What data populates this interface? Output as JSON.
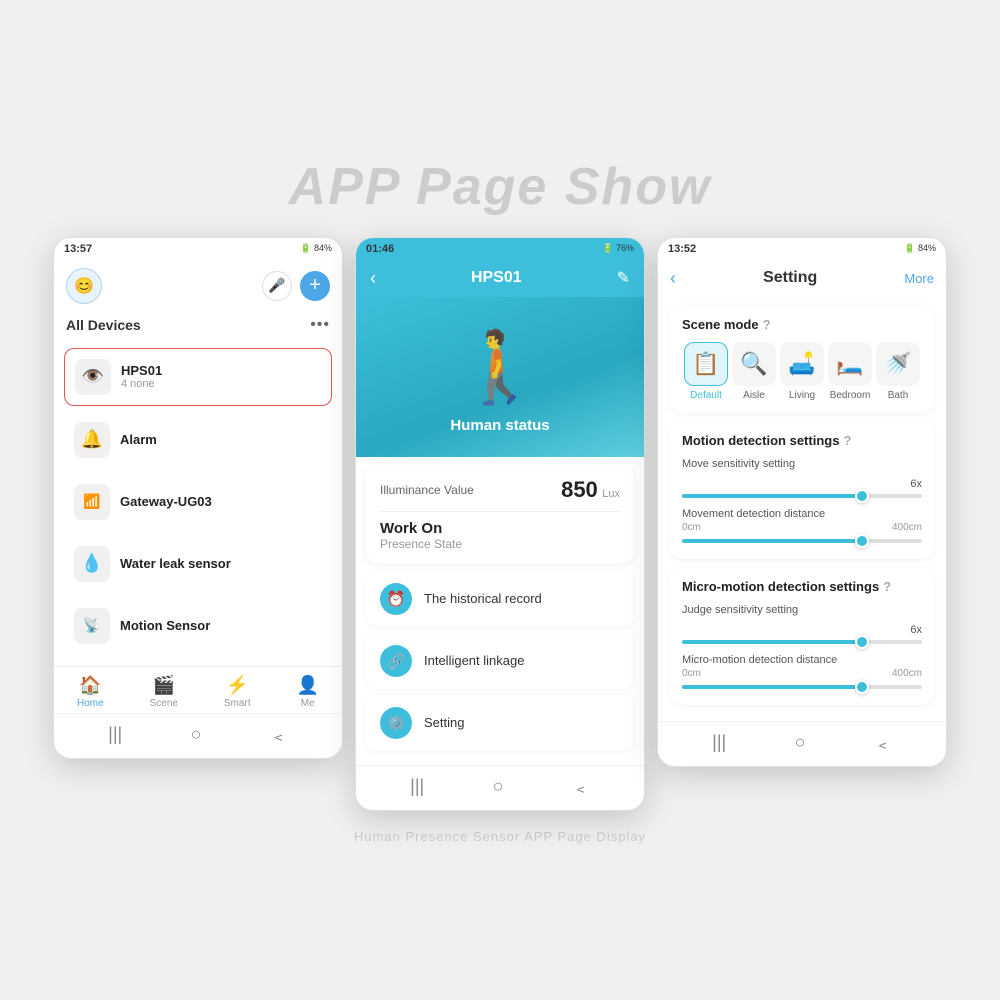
{
  "page": {
    "title": "APP Page Show",
    "footer": "Human Presence Sensor APP Page Display"
  },
  "phone1": {
    "status_time": "13:57",
    "status_icons": "🔋84%",
    "section_title": "All Devices",
    "devices": [
      {
        "name": "HPS01",
        "sub": "4 none",
        "icon": "🔍",
        "selected": true
      },
      {
        "name": "Alarm",
        "sub": "",
        "icon": "🔔",
        "selected": false
      },
      {
        "name": "Gateway-UG03",
        "sub": "",
        "icon": "📶",
        "selected": false
      },
      {
        "name": "Water leak sensor",
        "sub": "",
        "icon": "💧",
        "selected": false
      },
      {
        "name": "Motion Sensor",
        "sub": "",
        "icon": "📡",
        "selected": false
      }
    ],
    "nav": [
      {
        "label": "Home",
        "active": true,
        "icon": "🏠"
      },
      {
        "label": "Scene",
        "active": false,
        "icon": "🎬"
      },
      {
        "label": "Smart",
        "active": false,
        "icon": "⚡"
      },
      {
        "label": "Me",
        "active": false,
        "icon": "👤"
      }
    ]
  },
  "phone2": {
    "status_time": "01:46",
    "device_name": "HPS01",
    "human_status": "Human status",
    "illuminance_label": "Illuminance Value",
    "illuminance_value": "850",
    "illuminance_unit": "Lux",
    "work_on": "Work On",
    "presence_state": "Presence State",
    "menu": [
      {
        "label": "The historical record",
        "icon": "⏰"
      },
      {
        "label": "Intelligent linkage",
        "icon": "🔗"
      },
      {
        "label": "Setting",
        "icon": "⚙️"
      }
    ]
  },
  "phone3": {
    "status_time": "13:52",
    "header_title": "Setting",
    "header_more": "More",
    "scene_mode_title": "Scene mode",
    "scenes": [
      {
        "name": "Default",
        "icon": "📋",
        "active": true
      },
      {
        "name": "Aisle",
        "icon": "🔍",
        "active": false
      },
      {
        "name": "Living",
        "icon": "🛋️",
        "active": false
      },
      {
        "name": "Bedroom",
        "icon": "🛏️",
        "active": false
      },
      {
        "name": "Bath",
        "icon": "🚿",
        "active": false
      }
    ],
    "motion_detection_title": "Motion detection settings",
    "move_sensitivity_label": "Move sensitivity setting",
    "move_sensitivity_value": "6x",
    "move_sensitivity_pct": 75,
    "movement_distance_label": "Movement detection distance",
    "movement_distance_min": "0cm",
    "movement_distance_max": "400cm",
    "movement_distance_pct": 75,
    "micro_motion_title": "Micro-motion detection settings",
    "judge_sensitivity_label": "Judge sensitivity setting",
    "judge_sensitivity_value": "6x",
    "judge_sensitivity_pct": 75,
    "micro_distance_label": "Micro-motion detection distance",
    "micro_distance_min": "0cm",
    "micro_distance_max": "400cm",
    "micro_distance_pct": 75
  }
}
